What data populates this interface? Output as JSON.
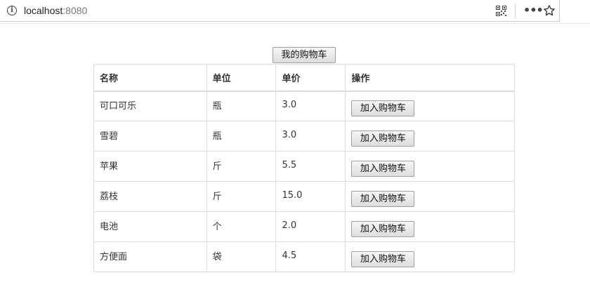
{
  "browser": {
    "url_host": "localhost",
    "url_port": ":8080",
    "more_label": "•••"
  },
  "page": {
    "cart_button_label": "我的购物车",
    "table": {
      "headers": [
        "名称",
        "单位",
        "单价",
        "操作"
      ],
      "add_button_label": "加入购物车",
      "rows": [
        {
          "name": "可口可乐",
          "unit": "瓶",
          "price": "3.0"
        },
        {
          "name": "雪碧",
          "unit": "瓶",
          "price": "3.0"
        },
        {
          "name": "苹果",
          "unit": "斤",
          "price": "5.5"
        },
        {
          "name": "荔枝",
          "unit": "斤",
          "price": "15.0"
        },
        {
          "name": "电池",
          "unit": "个",
          "price": "2.0"
        },
        {
          "name": "方便面",
          "unit": "袋",
          "price": "4.5"
        }
      ]
    }
  }
}
